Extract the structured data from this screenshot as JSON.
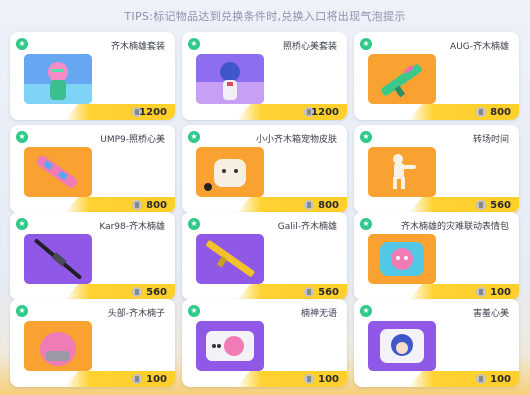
{
  "tips": "TIPS:标记物品达到兑换条件时,兑换入口将出现气泡提示",
  "colors": {
    "green_star": "#2fc98a",
    "price_yellow": "#ffd233",
    "thumb_orange": "#f9a232",
    "thumb_purple": "#8f58e6",
    "thumb_blue": "#67a7f1",
    "thumb_cyan": "#53c8e6"
  },
  "items": [
    {
      "name": "齐木楠雄套装",
      "price": "1200",
      "thumb": "character-pink"
    },
    {
      "name": "照桥心美套装",
      "price": "1200",
      "thumb": "character-blue"
    },
    {
      "name": "AUG-齐木楠雄",
      "price": "800",
      "thumb": "gun-green"
    },
    {
      "name": "UMP9-照桥心美",
      "price": "800",
      "thumb": "gun-pink"
    },
    {
      "name": "小小齐木箱宠物皮肤",
      "price": "800",
      "thumb": "pet-white"
    },
    {
      "name": "转场时间",
      "price": "560",
      "thumb": "figure-white"
    },
    {
      "name": "Kar98-齐木楠雄",
      "price": "560",
      "thumb": "rifle-dark"
    },
    {
      "name": "Galil-齐木楠雄",
      "price": "560",
      "thumb": "rifle-gold"
    },
    {
      "name": "齐木楠雄的灾难联动表情包",
      "price": "100",
      "thumb": "emote-pink"
    },
    {
      "name": "头部-齐木楠子",
      "price": "100",
      "thumb": "head-pink"
    },
    {
      "name": "楠神无语",
      "price": "100",
      "thumb": "emote-pink2"
    },
    {
      "name": "害羞心美",
      "price": "100",
      "thumb": "emote-blue"
    }
  ]
}
